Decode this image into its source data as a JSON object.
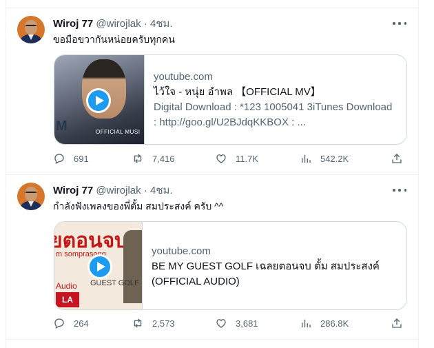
{
  "tweets": [
    {
      "name": "Wiroj 77",
      "handle": "@wirojlak",
      "dot": "·",
      "time": "4ชม.",
      "text": "ขอมือขวากันหน่อยครับทุกคน",
      "card": {
        "domain": "youtube.com",
        "title": "ไว้ใจ - หนุ่ย อำพล 【OFFICIAL MV】",
        "desc_line1": "Digital Download : *123 1005041 3iTunes Download",
        "desc_line2": ": http://goo.gl/U2BJdqKKBOX : ...",
        "thumb_logo": "M",
        "thumb_sub": "OFFICIAL MUSI"
      },
      "stats": {
        "replies": "691",
        "retweets": "7,416",
        "likes": "11.7K",
        "views": "542.2K"
      }
    },
    {
      "name": "Wiroj 77",
      "handle": "@wirojlak",
      "dot": "·",
      "time": "4ชม.",
      "text": "กำลังฟังเพลงของพี่ตั้ม สมประสงค์ ครับ ^^",
      "card": {
        "domain": "youtube.com",
        "title": "BE MY GUEST GOLF เฉลยตอนจบ ตั้ม สมประสงค์ (OFFICIAL AUDIO)",
        "thumb_title": "ยตอนจบ",
        "thumb_sub": "m somprasong",
        "thumb_audio": "Audio",
        "thumb_la": "LA",
        "thumb_mv": "GUEST GOLF"
      },
      "stats": {
        "replies": "264",
        "retweets": "2,573",
        "likes": "3,681",
        "views": "286.8K"
      }
    }
  ],
  "colors": {
    "accent": "#1d9bf0",
    "muted": "#536471",
    "border": "#cfd9de"
  }
}
